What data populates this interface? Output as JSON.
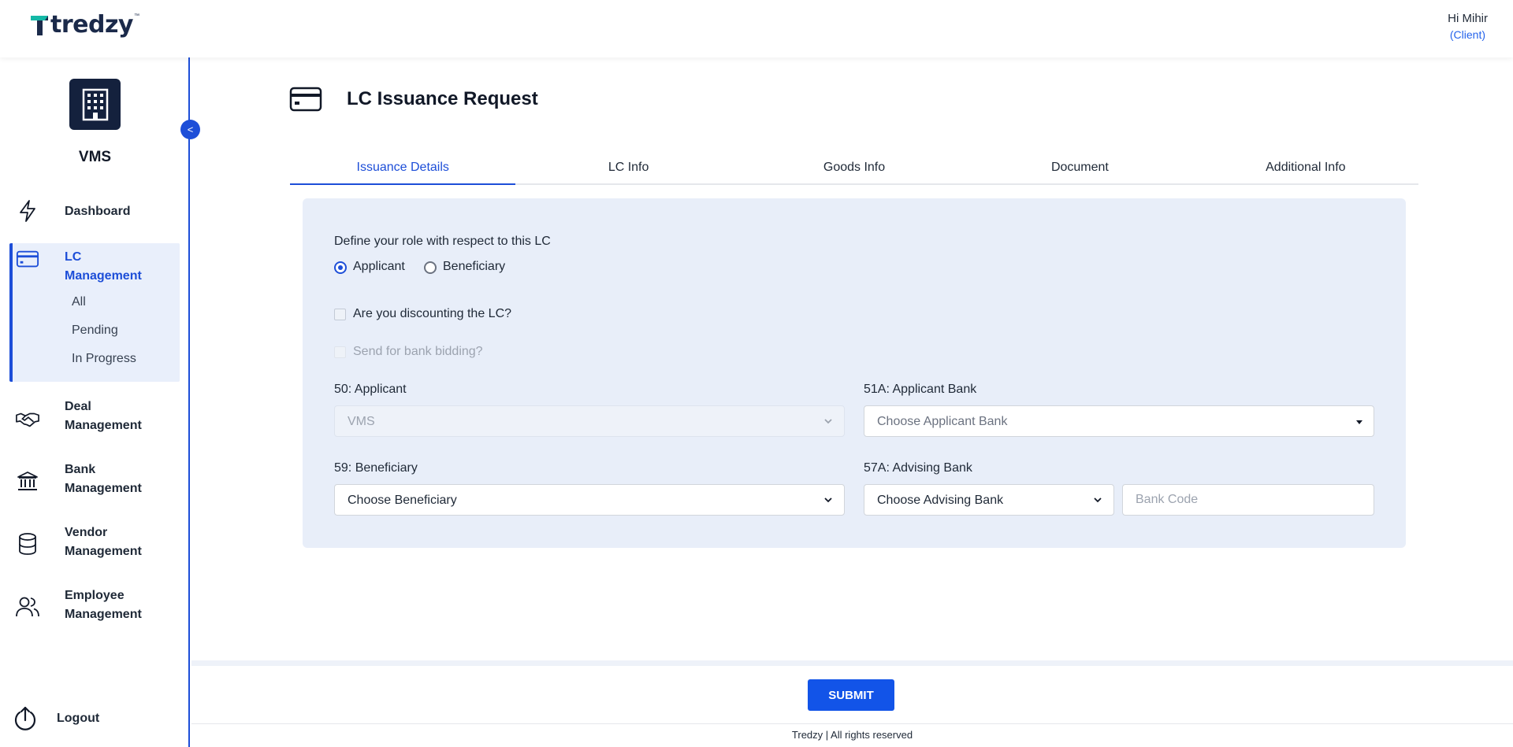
{
  "header": {
    "brand": "tredzy",
    "brand_tm": "™",
    "greeting": "Hi Mihir",
    "role": "(Client)"
  },
  "sidebar": {
    "org_name": "VMS",
    "collapse_label": "<",
    "items": [
      {
        "label": "Dashboard",
        "icon": "lightning-icon"
      },
      {
        "label": "LC Management",
        "icon": "credit-card-icon",
        "active": true,
        "sub_items": [
          "All",
          "Pending",
          "In Progress"
        ]
      },
      {
        "label": "Deal Management",
        "icon": "handshake-icon"
      },
      {
        "label": "Bank Management",
        "icon": "bank-icon"
      },
      {
        "label": "Vendor Management",
        "icon": "database-icon"
      },
      {
        "label": "Employee Management",
        "icon": "users-icon"
      }
    ],
    "logout_label": "Logout"
  },
  "page": {
    "title": "LC Issuance Request"
  },
  "tabs": [
    "Issuance Details",
    "LC Info",
    "Goods Info",
    "Document",
    "Additional Info"
  ],
  "form": {
    "role_question": "Define your role with respect to this LC",
    "role_options": [
      "Applicant",
      "Beneficiary"
    ],
    "role_selected": "Applicant",
    "discount_label": "Are you discounting the LC?",
    "bidding_label": "Send for bank bidding?",
    "applicant_label": "50: Applicant",
    "applicant_value": "VMS",
    "applicant_bank_label": "51A: Applicant Bank",
    "applicant_bank_placeholder": "Choose Applicant Bank",
    "beneficiary_label": "59: Beneficiary",
    "beneficiary_value": "Choose Beneficiary",
    "advising_bank_label": "57A: Advising Bank",
    "advising_bank_value": "Choose Advising Bank",
    "bank_code_placeholder": "Bank Code"
  },
  "footer": {
    "submit_label": "SUBMIT",
    "copyright": "Tredzy | All rights reserved"
  },
  "colors": {
    "accent": "#1d4ed8",
    "submit": "#1254e8",
    "panel_bg": "#e8eef9",
    "org_logo_bg": "#14213d",
    "brand_teal": "#14b8a6"
  }
}
